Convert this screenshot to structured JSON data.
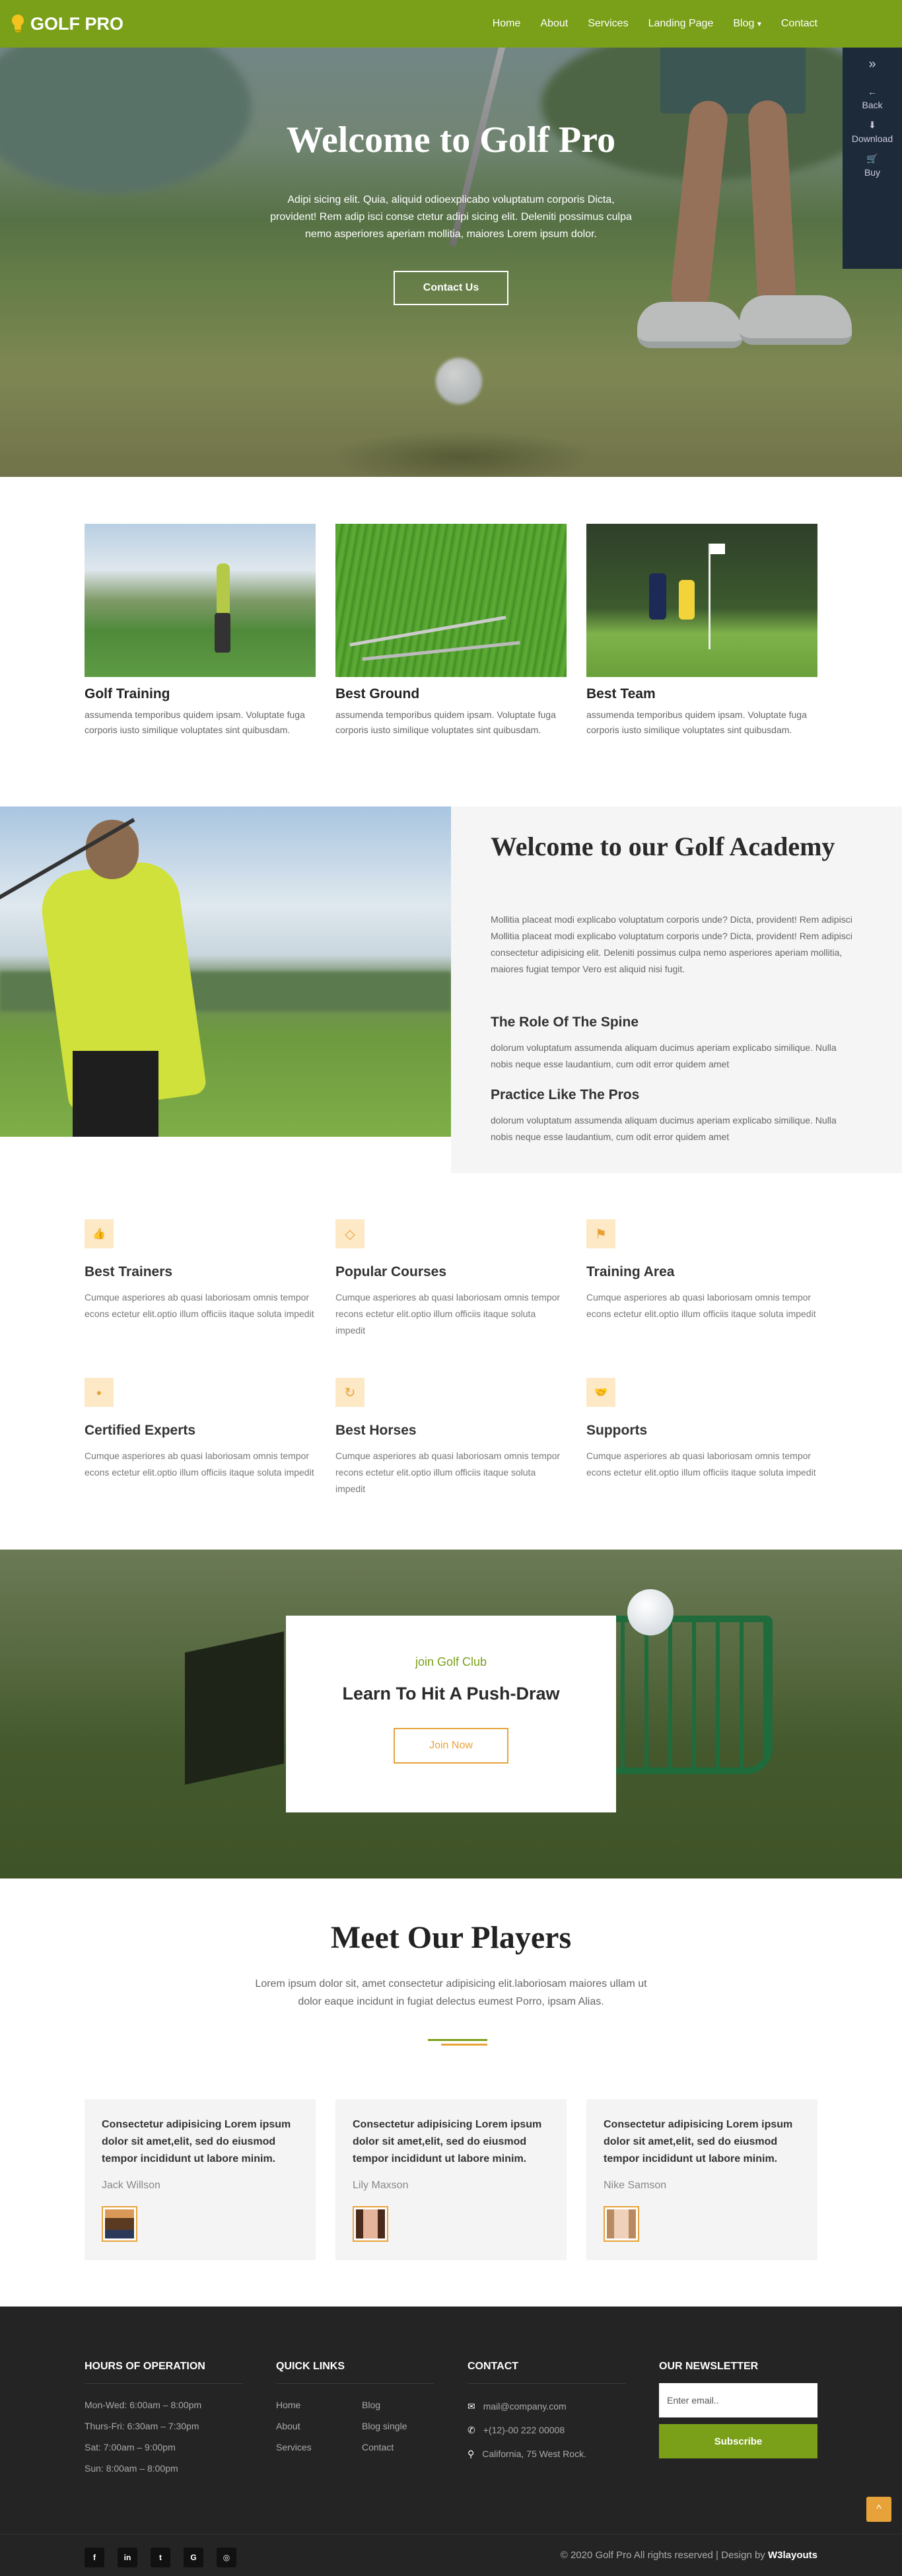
{
  "nav": {
    "brand": "GOLF PRO",
    "items": [
      "Home",
      "About",
      "Services",
      "Landing Page",
      "Blog",
      "Contact"
    ],
    "blog_caret": "▾"
  },
  "side_panel": {
    "items": [
      {
        "label": "",
        "icon": "double-chevron-right-icon"
      },
      {
        "label": "Back",
        "icon": "arrow-left-icon"
      },
      {
        "label": "Download",
        "icon": "download-icon"
      },
      {
        "label": "Buy",
        "icon": "cart-icon"
      }
    ]
  },
  "hero": {
    "title": "Welcome to Golf Pro",
    "text": "Adipi sicing elit. Quia, aliquid odioexplicabo voluptatum corporis Dicta, provident! Rem adip isci conse ctetur adipi sicing elit. Deleniti possimus culpa nemo asperiores aperiam mollitia, maiores Lorem ipsum dolor.",
    "button": "Contact Us"
  },
  "cards": [
    {
      "title": "Golf Training",
      "text": "assumenda temporibus quidem ipsam. Voluptate fuga corporis iusto similique voluptates sint quibusdam."
    },
    {
      "title": "Best Ground",
      "text": "assumenda temporibus quidem ipsam. Voluptate fuga corporis iusto similique voluptates sint quibusdam."
    },
    {
      "title": "Best Team",
      "text": "assumenda temporibus quidem ipsam. Voluptate fuga corporis iusto similique voluptates sint quibusdam."
    }
  ],
  "academy": {
    "title": "Welcome to our Golf Academy",
    "text": "Mollitia placeat modi explicabo voluptatum corporis unde? Dicta, provident! Rem adipisci Mollitia placeat modi explicabo voluptatum corporis unde? Dicta, provident! Rem adipisci consectetur adipisicing elit. Deleniti possimus culpa nemo asperiores aperiam mollitia, maiores fugiat tempor Vero est aliquid nisi fugit.",
    "h1": "The Role Of The Spine",
    "p1": "dolorum voluptatum assumenda aliquam ducimus aperiam explicabo similique. Nulla nobis neque esse laudantium, cum odit error quidem amet",
    "h2": "Practice Like The Pros",
    "p2": "dolorum voluptatum assumenda aliquam ducimus aperiam explicabo similique. Nulla nobis neque esse laudantium, cum odit error quidem amet"
  },
  "features": [
    {
      "title": "Best Trainers",
      "icon": "thumbs-up-icon",
      "glyph": "👍",
      "text": "Cumque asperiores ab quasi laboriosam omnis tempor econs ectetur elit.optio illum officiis itaque soluta impedit"
    },
    {
      "title": "Popular Courses",
      "icon": "diamond-icon",
      "glyph": "◇",
      "text": "Cumque asperiores ab quasi laboriosam omnis tempor recons ectetur elit.optio illum officiis itaque soluta impedit"
    },
    {
      "title": "Training Area",
      "icon": "flag-icon",
      "glyph": "⚑",
      "text": "Cumque asperiores ab quasi laboriosam omnis tempor econs ectetur elit.optio illum officiis itaque soluta impedit"
    },
    {
      "title": "Certified Experts",
      "icon": "user-icon",
      "glyph": "●",
      "text": "Cumque asperiores ab quasi laboriosam omnis tempor econs ectetur elit.optio illum officiis itaque soluta impedit"
    },
    {
      "title": "Best Horses",
      "icon": "refresh-icon",
      "glyph": "↻",
      "text": "Cumque asperiores ab quasi laboriosam omnis tempor recons ectetur elit.optio illum officiis itaque soluta impedit"
    },
    {
      "title": "Supports",
      "icon": "handshake-icon",
      "glyph": "🤝",
      "text": "Cumque asperiores ab quasi laboriosam omnis tempor econs ectetur elit.optio illum officiis itaque soluta impedit"
    }
  ],
  "join": {
    "sub": "join Golf Club",
    "title": "Learn To Hit A Push-Draw",
    "button": "Join Now"
  },
  "players": {
    "title": "Meet Our Players",
    "text": "Lorem ipsum dolor sit, amet consectetur adipisicing elit.laboriosam maiores ullam ut dolor eaque incidunt in fugiat delectus eumest Porro, ipsam Alias.",
    "list": [
      {
        "quote": "Consectetur adipisicing Lorem ipsum dolor sit amet,elit, sed do eiusmod tempor incididunt ut labore minim.",
        "name": "Jack Willson"
      },
      {
        "quote": "Consectetur adipisicing Lorem ipsum dolor sit amet,elit, sed do eiusmod tempor incididunt ut labore minim.",
        "name": "Lily Maxson"
      },
      {
        "quote": "Consectetur adipisicing Lorem ipsum dolor sit amet,elit, sed do eiusmod tempor incididunt ut labore minim.",
        "name": "Nike Samson"
      }
    ]
  },
  "footer": {
    "hours_title": "HOURS OF OPERATION",
    "hours": [
      "Mon-Wed: 6:00am – 8:00pm",
      "Thurs-Fri: 6:30am – 7:30pm",
      "Sat: 7:00am – 9:00pm",
      "Sun: 8:00am – 8:00pm"
    ],
    "links_title": "QUICK LINKS",
    "links_col1": [
      "Home",
      "About",
      "Services"
    ],
    "links_col2": [
      "Blog",
      "Blog single",
      "Contact"
    ],
    "contact_title": "CONTACT",
    "contact": [
      {
        "icon": "mail-icon",
        "glyph": "✉",
        "text": "mail@company.com"
      },
      {
        "icon": "phone-icon",
        "glyph": "✆",
        "text": "+(12)-00 222 00008"
      },
      {
        "icon": "location-icon",
        "glyph": "⚲",
        "text": "California, 75 West Rock."
      }
    ],
    "newsletter_title": "OUR NEWSLETTER",
    "email_placeholder": "Enter email..",
    "subscribe": "Subscribe",
    "socials": [
      {
        "icon": "facebook-icon",
        "glyph": "f"
      },
      {
        "icon": "linkedin-icon",
        "glyph": "in"
      },
      {
        "icon": "twitter-icon",
        "glyph": "t"
      },
      {
        "icon": "google-icon",
        "glyph": "G"
      },
      {
        "icon": "github-icon",
        "glyph": "◎"
      }
    ],
    "copyright": "© 2020 Golf Pro All rights reserved | Design by ",
    "designer": "W3layouts",
    "to_top": "^"
  },
  "colors": {
    "brand_green": "#7aa01a",
    "accent_orange": "#e8a23a",
    "footer_bg": "#242424"
  }
}
